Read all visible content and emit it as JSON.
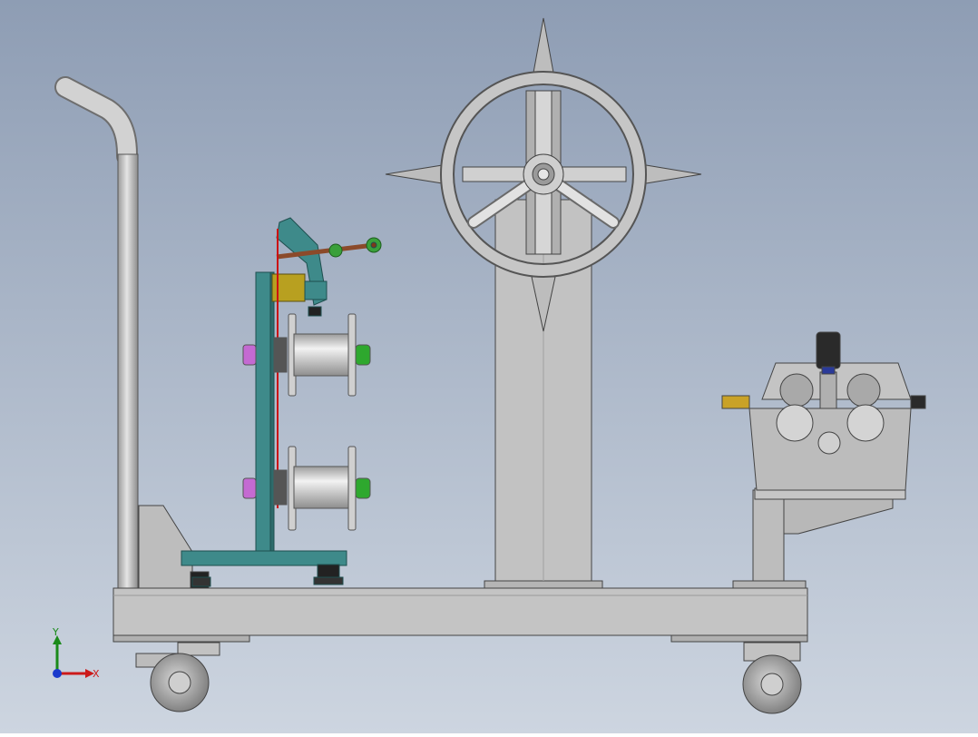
{
  "triad": {
    "y_label": "Y",
    "x_label": "X"
  },
  "colors": {
    "bg_top": "#8e9db4",
    "bg_bottom": "#cdd5e0",
    "steel": "#c8c8c8",
    "steel_dark": "#8a8a8a",
    "frame_teal": "#3e8a8a",
    "brass": "#c9a227",
    "pink": "#c46ad2",
    "green": "#2ea82e",
    "rust": "#8b4a2a",
    "olive": "#b8a020",
    "wire_red": "#cc1111"
  }
}
